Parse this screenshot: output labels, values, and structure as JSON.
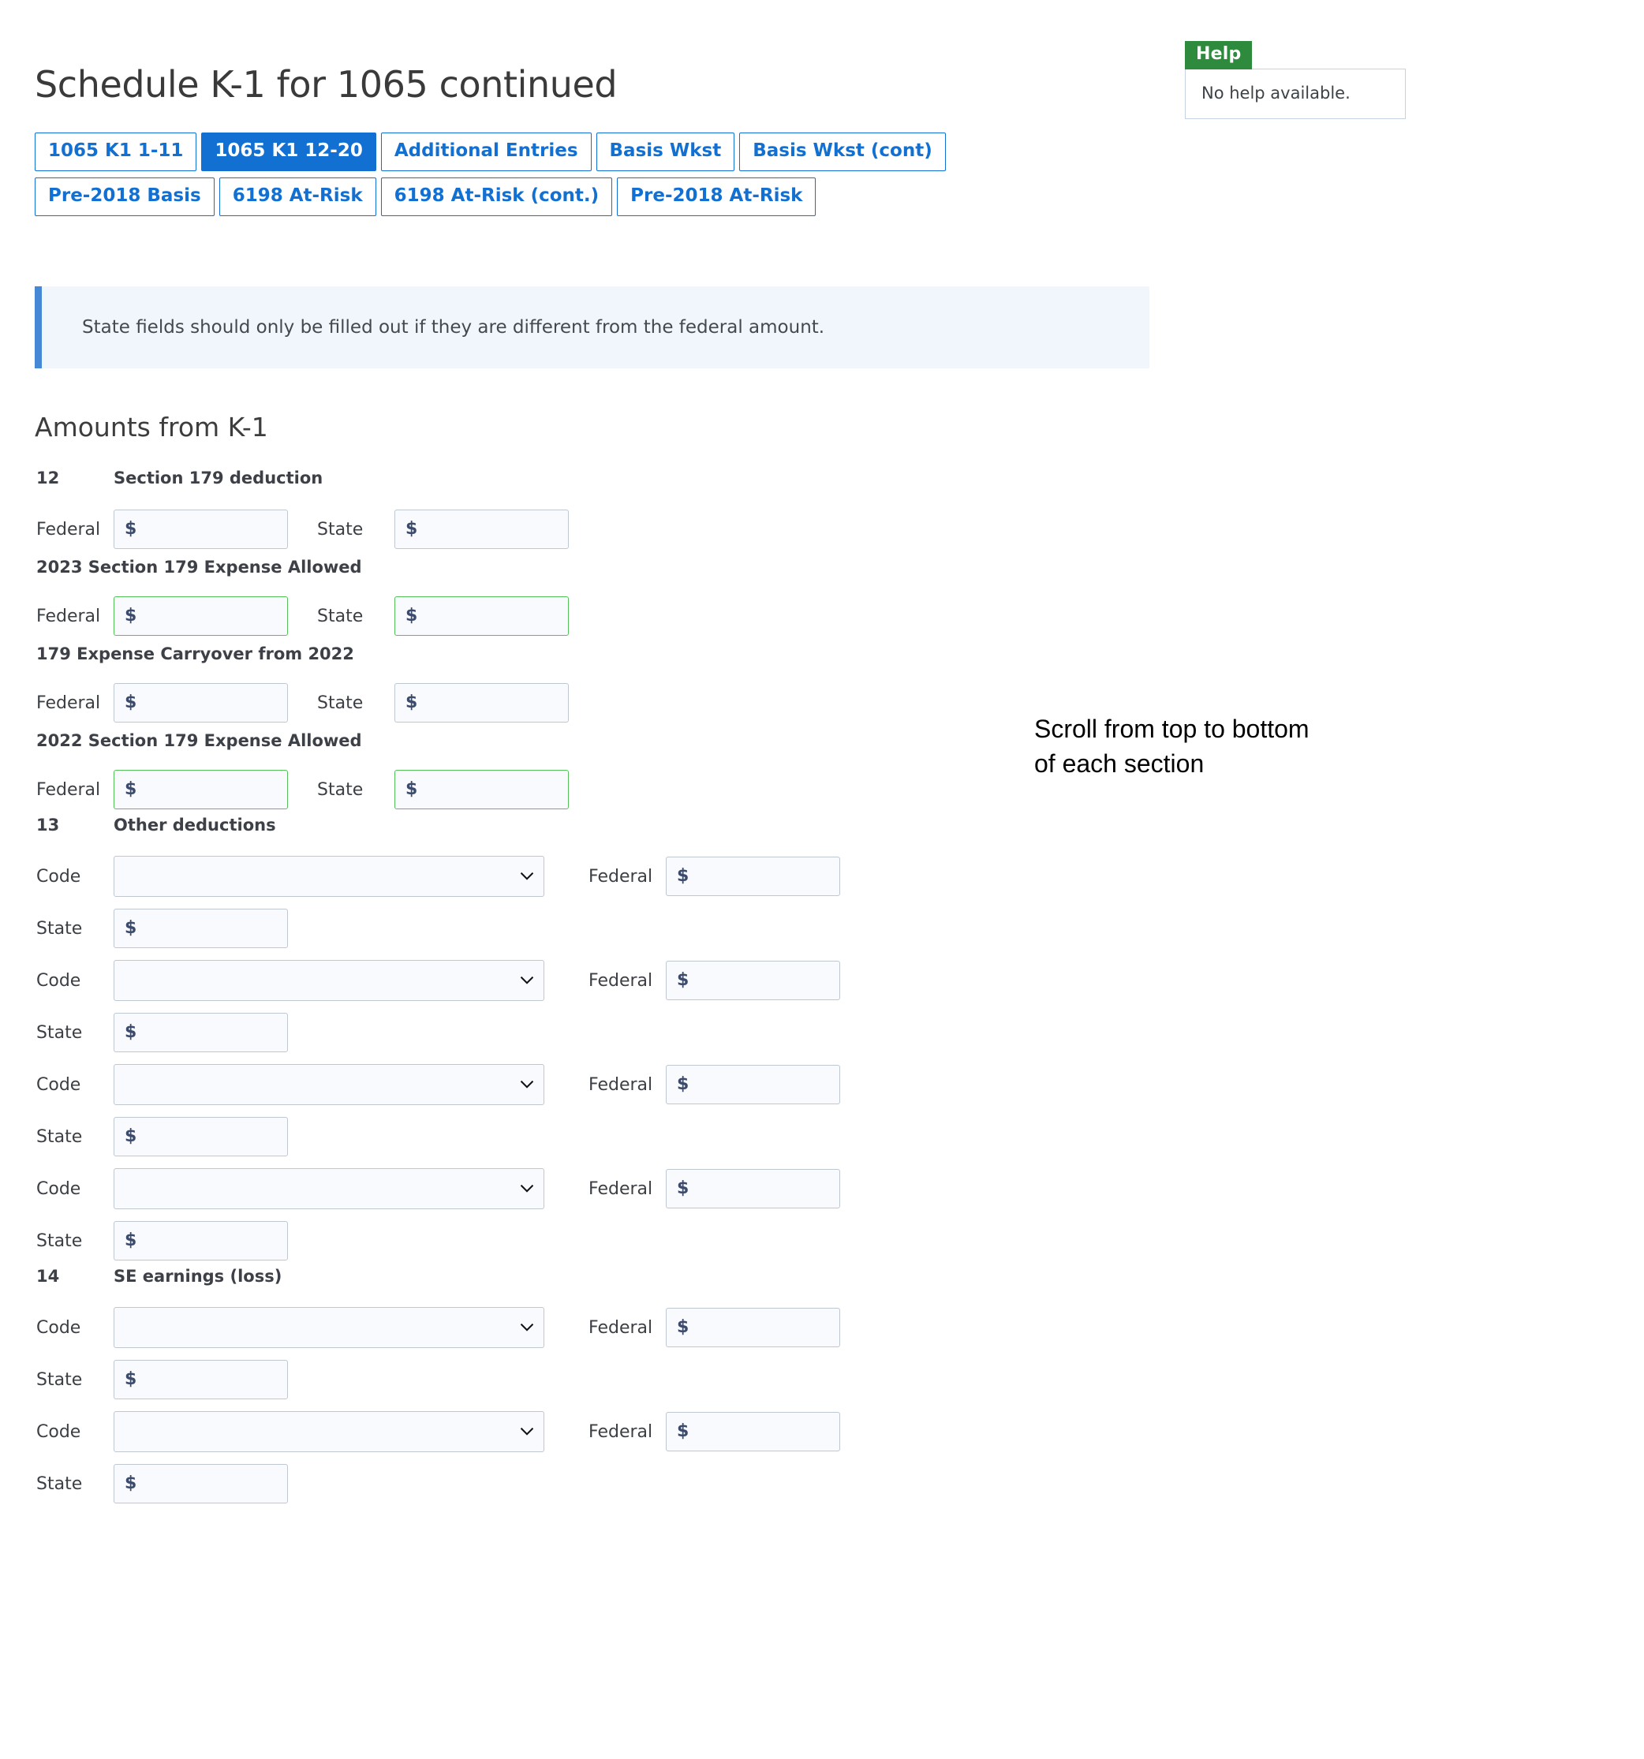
{
  "page": {
    "title": "Schedule K-1 for 1065 continued",
    "section_heading": "Amounts from K-1",
    "info_banner": "State fields should only be filled out if they are different from the federal amount."
  },
  "help": {
    "badge_label": "Help",
    "body_text": "No help available."
  },
  "annotation": {
    "text": "Scroll from top to bottom\nof each section"
  },
  "tabs": [
    {
      "label": "1065 K1 1-11",
      "active": false
    },
    {
      "label": "1065 K1 12-20",
      "active": true
    },
    {
      "label": "Additional Entries",
      "active": false
    },
    {
      "label": "Basis Wkst",
      "active": false
    },
    {
      "label": "Basis Wkst (cont)",
      "active": false
    },
    {
      "label": "Pre-2018 Basis",
      "active": false
    },
    {
      "label": "6198 At-Risk",
      "active": false
    },
    {
      "label": "6198 At-Risk (cont.)",
      "active": false
    },
    {
      "label": "Pre-2018 At-Risk",
      "active": false
    }
  ],
  "labels": {
    "federal": "Federal",
    "state": "State",
    "code": "Code",
    "dollar": "$"
  },
  "fields": {
    "money_placeholder": "",
    "money_value": "",
    "select_value": "",
    "select_options": [
      ""
    ]
  },
  "sections": [
    {
      "kind": "money_pair",
      "number": "12",
      "label": "Section 179 deduction",
      "green": false
    },
    {
      "kind": "money_pair",
      "number": "",
      "label": "2023 Section 179 Expense Allowed",
      "green": true
    },
    {
      "kind": "money_pair",
      "number": "",
      "label": "179 Expense Carryover from 2022",
      "green": false
    },
    {
      "kind": "money_pair",
      "number": "",
      "label": "2022 Section 179 Expense Allowed",
      "green": true
    },
    {
      "kind": "code_group",
      "number": "13",
      "label": "Other deductions",
      "rows": 4
    },
    {
      "kind": "code_group",
      "number": "14",
      "label": "SE earnings (loss)",
      "rows": 2
    }
  ],
  "colors": {
    "accent_blue": "#1270d3",
    "info_border": "#4688d6",
    "info_bg": "#f1f6fd",
    "help_green": "#2e8b3d",
    "valid_green": "#55c158",
    "input_bg": "#f8fafd",
    "input_border": "#bfc7d1",
    "dollar_color": "#3c4a6b"
  }
}
